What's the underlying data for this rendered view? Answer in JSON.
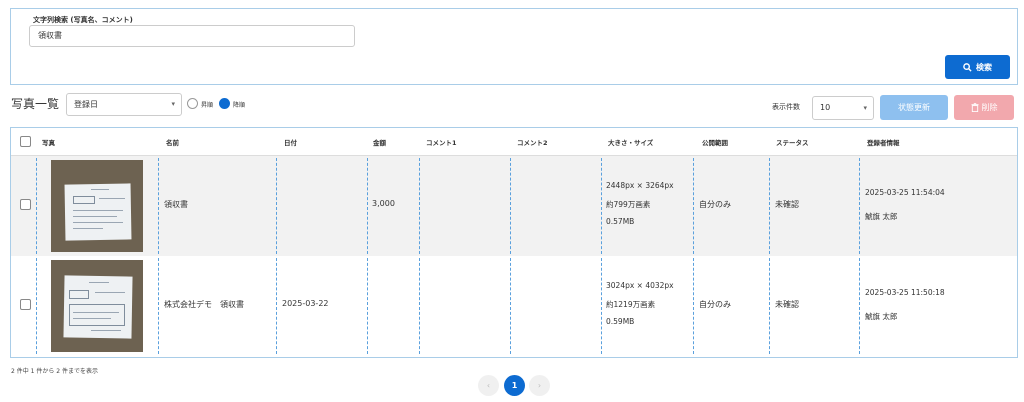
{
  "search": {
    "label": "文字列検索 (写真名、コメント)",
    "value": "領収書",
    "button_label": "検索",
    "button_icon": "search-icon"
  },
  "list": {
    "title": "写真一覧",
    "sort_field": "登録日",
    "sort_order_options": [
      "昇順",
      "降順"
    ],
    "sort_order_selected": "降順",
    "per_page_label": "表示件数",
    "per_page_value": "10",
    "status_update_label": "状態更新",
    "delete_label": "削除",
    "delete_icon": "trash-icon"
  },
  "table": {
    "columns": [
      "写真",
      "名前",
      "日付",
      "金額",
      "コメント1",
      "コメント2",
      "大きさ・サイズ",
      "公開範囲",
      "ステータス",
      "登録者情報"
    ],
    "rows": [
      {
        "name": "領収書",
        "date": "",
        "amount": "3,000",
        "comment1": "",
        "comment2": "",
        "dimensions": "2448px × 3264px",
        "pixels": "約799万画素",
        "filesize": "0.57MB",
        "visibility": "自分のみ",
        "status": "未確認",
        "registered_at": "2025-03-25 11:54:04",
        "registered_by": "鯱旗 太郎"
      },
      {
        "name": "株式会社デモ　領収書",
        "date": "2025-03-22",
        "amount": "",
        "comment1": "",
        "comment2": "",
        "dimensions": "3024px × 4032px",
        "pixels": "約1219万画素",
        "filesize": "0.59MB",
        "visibility": "自分のみ",
        "status": "未確認",
        "registered_at": "2025-03-25 11:50:18",
        "registered_by": "鯱旗 太郎"
      }
    ]
  },
  "pagination": {
    "summary": "2 件中 1 件から 2 件までを表示",
    "prev": "‹",
    "current": "1",
    "next": "›"
  },
  "colors": {
    "primary": "#0d6bd1",
    "status_update_disabled": "#8ec0ef",
    "delete_disabled": "#f2a8ad",
    "panel_border": "#a9cde8"
  }
}
